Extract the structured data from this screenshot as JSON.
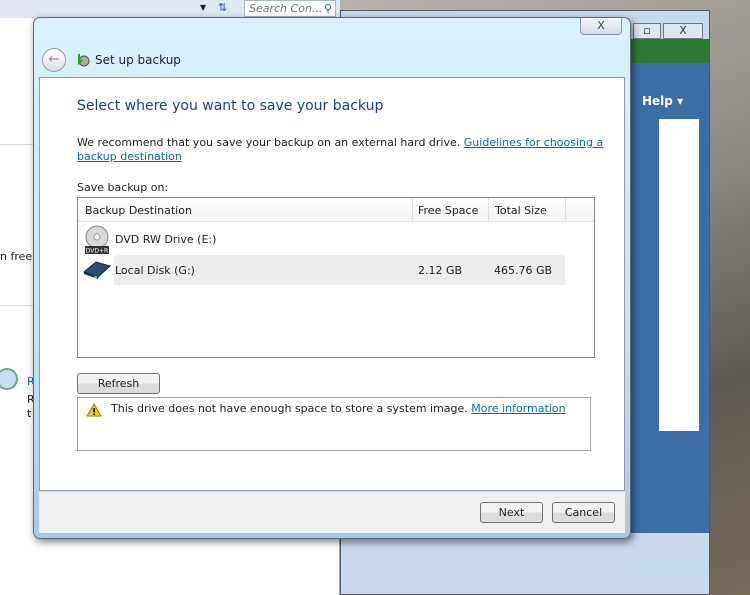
{
  "background": {
    "search_placeholder": "Search Con...",
    "left_fragments": [
      "n free s",
      "R",
      "R",
      "t"
    ],
    "help_label": "Help"
  },
  "dialog": {
    "title": "Set up backup",
    "close_label": "X",
    "heading": "Select where you want to save your backup",
    "recommendation": "We recommend that you save your backup on an external hard drive.",
    "guidelines_link": "Guidelines for choosing a backup destination",
    "save_on_label": "Save backup on:",
    "columns": [
      "Backup Destination",
      "Free Space",
      "Total Size"
    ],
    "destinations": [
      {
        "name": "DVD RW Drive (E:)",
        "free": "",
        "total": "",
        "icon": "dvd-drive-icon",
        "icon_label": "DVD+R"
      },
      {
        "name": "Local Disk (G:)",
        "free": "2.12 GB",
        "total": "465.76 GB",
        "icon": "hard-disk-icon",
        "selected": true
      }
    ],
    "refresh_label": "Refresh",
    "warning_text": "This drive does not have enough space to store a system image.",
    "more_info_link": "More information",
    "next_label": "Next",
    "cancel_label": "Cancel"
  },
  "colors": {
    "heading": "#1a3ba0",
    "link": "#0066cc",
    "selection": "#ededed"
  }
}
